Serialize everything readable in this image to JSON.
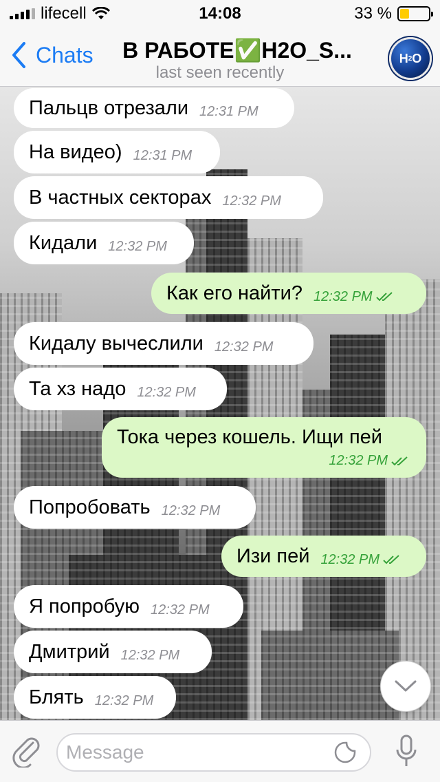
{
  "status_bar": {
    "carrier": "lifecell",
    "time": "14:08",
    "battery_text": "33 %",
    "battery_level": 0.33,
    "battery_color": "#ffcc00"
  },
  "nav": {
    "back_label": "Chats",
    "title": "В РАБОТЕ✅H2O_S...",
    "subtitle": "last seen recently",
    "avatar_text": "H",
    "avatar_sub": "2",
    "avatar_suffix": "O",
    "accent_color": "#1c7cf4"
  },
  "messages": [
    {
      "direction": "in",
      "text": "Пальцв отрезали",
      "time": "12:31 PM"
    },
    {
      "direction": "in",
      "text": "На видео)",
      "time": "12:31 PM"
    },
    {
      "direction": "in",
      "text": "В частных секторах",
      "time": "12:32 PM"
    },
    {
      "direction": "in",
      "text": "Кидали",
      "time": "12:32 PM"
    },
    {
      "direction": "out",
      "text": "Как его найти?",
      "time": "12:32 PM",
      "status": "read"
    },
    {
      "direction": "in",
      "text": "Кидалу вычеслили",
      "time": "12:32 PM"
    },
    {
      "direction": "in",
      "text": "Та хз надо",
      "time": "12:32 PM"
    },
    {
      "direction": "out",
      "text": "Тока через кошель. Ищи пей",
      "time": "12:32 PM",
      "status": "read"
    },
    {
      "direction": "in",
      "text": "Попробовать",
      "time": "12:32 PM"
    },
    {
      "direction": "out",
      "text": "Изи пей",
      "time": "12:32 PM",
      "status": "read"
    },
    {
      "direction": "in",
      "text": "Я попробую",
      "time": "12:32 PM"
    },
    {
      "direction": "in",
      "text": "Дмитрий",
      "time": "12:32 PM"
    },
    {
      "direction": "in",
      "text": "Блять",
      "time": "12:32 PM"
    }
  ],
  "input": {
    "placeholder": "Message"
  },
  "icons": {
    "back": "chevron-left-icon",
    "attach": "paperclip-icon",
    "sticker": "sticker-icon",
    "mic": "microphone-icon",
    "scroll_down": "chevron-down-icon",
    "read": "double-check-icon"
  },
  "colors": {
    "incoming_bubble": "#ffffff",
    "outgoing_bubble": "#dcf8c6",
    "outgoing_time": "#36a23a"
  }
}
